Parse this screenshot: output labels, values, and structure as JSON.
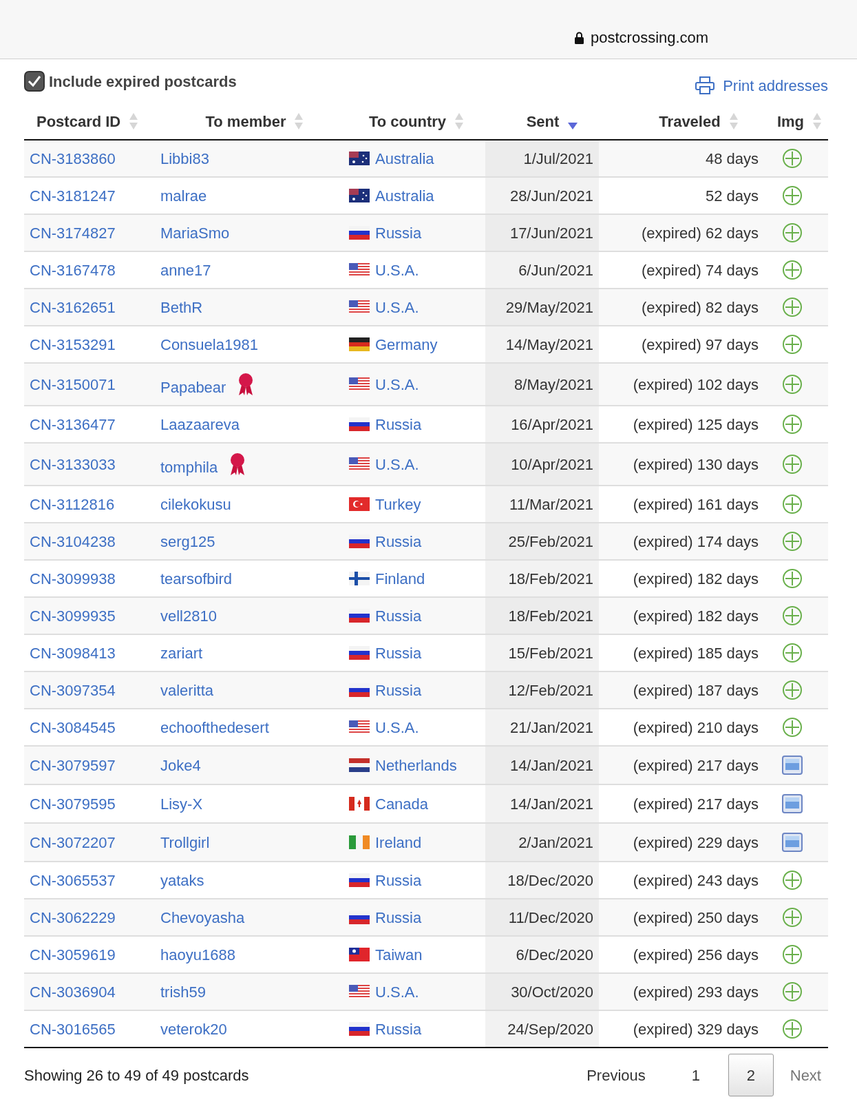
{
  "browser": {
    "domain": "postcrossing.com"
  },
  "filter": {
    "label": "Include expired postcards",
    "checked": true
  },
  "print_link": "Print addresses",
  "table": {
    "columns": [
      {
        "label": "Postcard ID",
        "sorted": false
      },
      {
        "label": "To member",
        "sorted": false
      },
      {
        "label": "To country",
        "sorted": false
      },
      {
        "label": "Sent",
        "sorted": true
      },
      {
        "label": "Traveled",
        "sorted": false
      },
      {
        "label": "Img",
        "sorted": false
      }
    ],
    "rows": [
      {
        "id": "CN-3183860",
        "member": "Libbi83",
        "badge": false,
        "flag": {
          "kind": "au"
        },
        "country": "Australia",
        "sent": "1/Jul/2021",
        "traveled": "48 days",
        "image": {
          "kind": "add"
        }
      },
      {
        "id": "CN-3181247",
        "member": "malrae",
        "badge": false,
        "flag": {
          "kind": "au"
        },
        "country": "Australia",
        "sent": "28/Jun/2021",
        "traveled": "52 days",
        "image": {
          "kind": "add"
        }
      },
      {
        "id": "CN-3174827",
        "member": "MariaSmo",
        "badge": false,
        "flag": {
          "kind": "ru"
        },
        "country": "Russia",
        "sent": "17/Jun/2021",
        "traveled": "(expired) 62 days",
        "image": {
          "kind": "add"
        }
      },
      {
        "id": "CN-3167478",
        "member": "anne17",
        "badge": false,
        "flag": {
          "kind": "us"
        },
        "country": "U.S.A.",
        "sent": "6/Jun/2021",
        "traveled": "(expired) 74 days",
        "image": {
          "kind": "add"
        }
      },
      {
        "id": "CN-3162651",
        "member": "BethR",
        "badge": false,
        "flag": {
          "kind": "us"
        },
        "country": "U.S.A.",
        "sent": "29/May/2021",
        "traveled": "(expired) 82 days",
        "image": {
          "kind": "add"
        }
      },
      {
        "id": "CN-3153291",
        "member": "Consuela1981",
        "badge": false,
        "flag": {
          "kind": "de"
        },
        "country": "Germany",
        "sent": "14/May/2021",
        "traveled": "(expired) 97 days",
        "image": {
          "kind": "add"
        }
      },
      {
        "id": "CN-3150071",
        "member": "Papabear",
        "badge": true,
        "flag": {
          "kind": "us"
        },
        "country": "U.S.A.",
        "sent": "8/May/2021",
        "traveled": "(expired) 102 days",
        "image": {
          "kind": "add"
        }
      },
      {
        "id": "CN-3136477",
        "member": "Laazaareva",
        "badge": false,
        "flag": {
          "kind": "ru"
        },
        "country": "Russia",
        "sent": "16/Apr/2021",
        "traveled": "(expired) 125 days",
        "image": {
          "kind": "add"
        }
      },
      {
        "id": "CN-3133033",
        "member": "tomphila",
        "badge": true,
        "flag": {
          "kind": "us"
        },
        "country": "U.S.A.",
        "sent": "10/Apr/2021",
        "traveled": "(expired) 130 days",
        "image": {
          "kind": "add"
        }
      },
      {
        "id": "CN-3112816",
        "member": "cilekokusu",
        "badge": false,
        "flag": {
          "kind": "tr"
        },
        "country": "Turkey",
        "sent": "11/Mar/2021",
        "traveled": "(expired) 161 days",
        "image": {
          "kind": "add"
        }
      },
      {
        "id": "CN-3104238",
        "member": "serg125",
        "badge": false,
        "flag": {
          "kind": "ru"
        },
        "country": "Russia",
        "sent": "25/Feb/2021",
        "traveled": "(expired) 174 days",
        "image": {
          "kind": "add"
        }
      },
      {
        "id": "CN-3099938",
        "member": "tearsofbird",
        "badge": false,
        "flag": {
          "kind": "fi"
        },
        "country": "Finland",
        "sent": "18/Feb/2021",
        "traveled": "(expired) 182 days",
        "image": {
          "kind": "add"
        }
      },
      {
        "id": "CN-3099935",
        "member": "vell2810",
        "badge": false,
        "flag": {
          "kind": "ru"
        },
        "country": "Russia",
        "sent": "18/Feb/2021",
        "traveled": "(expired) 182 days",
        "image": {
          "kind": "add"
        }
      },
      {
        "id": "CN-3098413",
        "member": "zariart",
        "badge": false,
        "flag": {
          "kind": "ru"
        },
        "country": "Russia",
        "sent": "15/Feb/2021",
        "traveled": "(expired) 185 days",
        "image": {
          "kind": "add"
        }
      },
      {
        "id": "CN-3097354",
        "member": "valeritta",
        "badge": false,
        "flag": {
          "kind": "ru"
        },
        "country": "Russia",
        "sent": "12/Feb/2021",
        "traveled": "(expired) 187 days",
        "image": {
          "kind": "add"
        }
      },
      {
        "id": "CN-3084545",
        "member": "echoofthedesert",
        "badge": false,
        "flag": {
          "kind": "us"
        },
        "country": "U.S.A.",
        "sent": "21/Jan/2021",
        "traveled": "(expired) 210 days",
        "image": {
          "kind": "add"
        }
      },
      {
        "id": "CN-3079597",
        "member": "Joke4",
        "badge": false,
        "flag": {
          "kind": "nl"
        },
        "country": "Netherlands",
        "sent": "14/Jan/2021",
        "traveled": "(expired) 217 days"
      },
      {
        "id": "CN-3079595",
        "member": "Lisy-X",
        "badge": false,
        "flag": {
          "kind": "ca"
        },
        "country": "Canada",
        "sent": "14/Jan/2021",
        "traveled": "(expired) 217 days"
      },
      {
        "id": "CN-3072207",
        "member": "Trollgirl",
        "badge": false,
        "flag": {
          "kind": "ie"
        },
        "country": "Ireland",
        "sent": "2/Jan/2021",
        "traveled": "(expired) 229 days"
      },
      {
        "id": "CN-3065537",
        "member": "yataks",
        "badge": false,
        "flag": {
          "kind": "ru"
        },
        "country": "Russia",
        "sent": "18/Dec/2020",
        "traveled": "(expired) 243 days",
        "image": {
          "kind": "add"
        }
      },
      {
        "id": "CN-3062229",
        "member": "Chevoyasha",
        "badge": false,
        "flag": {
          "kind": "ru"
        },
        "country": "Russia",
        "sent": "11/Dec/2020",
        "traveled": "(expired) 250 days",
        "image": {
          "kind": "add"
        }
      },
      {
        "id": "CN-3059619",
        "member": "haoyu1688",
        "badge": false,
        "flag": {
          "kind": "tw"
        },
        "country": "Taiwan",
        "sent": "6/Dec/2020",
        "traveled": "(expired) 256 days",
        "image": {
          "kind": "add"
        }
      },
      {
        "id": "CN-3036904",
        "member": "trish59",
        "badge": false,
        "flag": {
          "kind": "us"
        },
        "country": "U.S.A.",
        "sent": "30/Oct/2020",
        "traveled": "(expired) 293 days",
        "image": {
          "kind": "add"
        }
      },
      {
        "id": "CN-3016565",
        "member": "veterok20",
        "badge": false,
        "flag": {
          "kind": "ru"
        },
        "country": "Russia",
        "sent": "24/Sep/2020",
        "traveled": "(expired) 329 days",
        "image": {
          "kind": "add"
        }
      }
    ]
  },
  "footer": {
    "summary": "Showing 26 to 49 of 49 postcards",
    "previous": "Previous",
    "pages": [
      {
        "label": "1",
        "selected": false
      },
      {
        "label": "2",
        "selected": true
      }
    ],
    "next": "Next"
  }
}
